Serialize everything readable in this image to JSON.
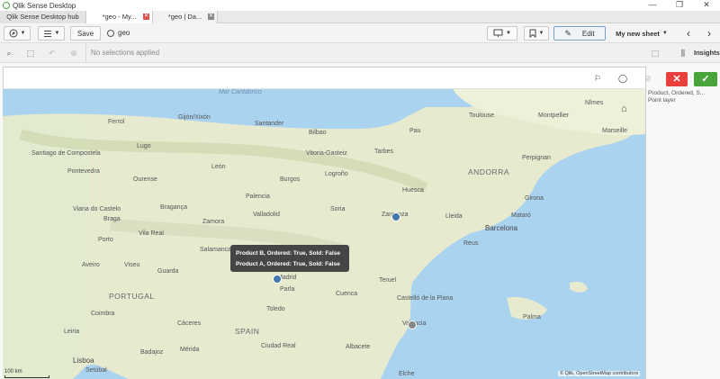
{
  "window": {
    "title": "Qlik Sense Desktop",
    "minimize": "—",
    "restore": "❐",
    "close": "✕"
  },
  "tabs": [
    {
      "label": "Qlik Sense Desktop hub"
    },
    {
      "label": "*geo - My...",
      "close": "✕"
    },
    {
      "label": "*geo | Da...",
      "close": "✕"
    }
  ],
  "toolbar": {
    "nav_icon": "compass-icon",
    "list_icon": "list-icon",
    "save_label": "Save",
    "app_name": "geo",
    "present_icon": "present-icon",
    "bookmark_icon": "bookmark-icon",
    "edit_label": "Edit",
    "sheet_name": "My new sheet",
    "prev": "‹",
    "next": "›"
  },
  "selections": {
    "no_selections": "No selections applied",
    "insights_label": "Insights"
  },
  "map": {
    "legend_line1": "Product, Ordered, S...",
    "legend_line2": "Point layer",
    "sea_label": "Mar Cantábrico",
    "countries": [
      "PORTUGAL",
      "SPAIN",
      "ANDORRA"
    ],
    "cities": [
      "Ferrol",
      "Gijón/Xixón",
      "Santander",
      "Bilbao",
      "Pau",
      "Toulouse",
      "Montpellier",
      "Nîmes",
      "Marseille",
      "Santiago de Compostela",
      "Lugo",
      "Vitoria-Gasteiz",
      "Tarbes",
      "Perpignan",
      "Pontevedra",
      "Ourense",
      "León",
      "Burgos",
      "Logroño",
      "Huesca",
      "Girona",
      "Viana do Castelo",
      "Bragança",
      "Palencia",
      "Soria",
      "Zaragoza",
      "Lleida",
      "Mataró",
      "Braga",
      "Zamora",
      "Valladolid",
      "Barcelona",
      "Porto",
      "Vila Real",
      "Salamanca",
      "Reus",
      "Aveiro",
      "Viseu",
      "Guarda",
      "Madrid",
      "Teruel",
      "Parla",
      "Cuenca",
      "Castelló de la Plana",
      "Coimbra",
      "Leiria",
      "Toledo",
      "Valencia",
      "Cáceres",
      "Palma",
      "Badajoz",
      "Mérida",
      "Ciudad Real",
      "Albacete",
      "Lisboa",
      "Setúbal",
      "Elche"
    ],
    "scale_label": "100 km",
    "attribution": "© Qlik, OpenStreetMap contributors",
    "tooltip_line1": "Product B, Ordered: True, Sold: False",
    "tooltip_line2": "Product A, Ordered: True, Sold: False",
    "point_colors": {
      "blue": "#4477aa",
      "grey": "#888888"
    }
  }
}
